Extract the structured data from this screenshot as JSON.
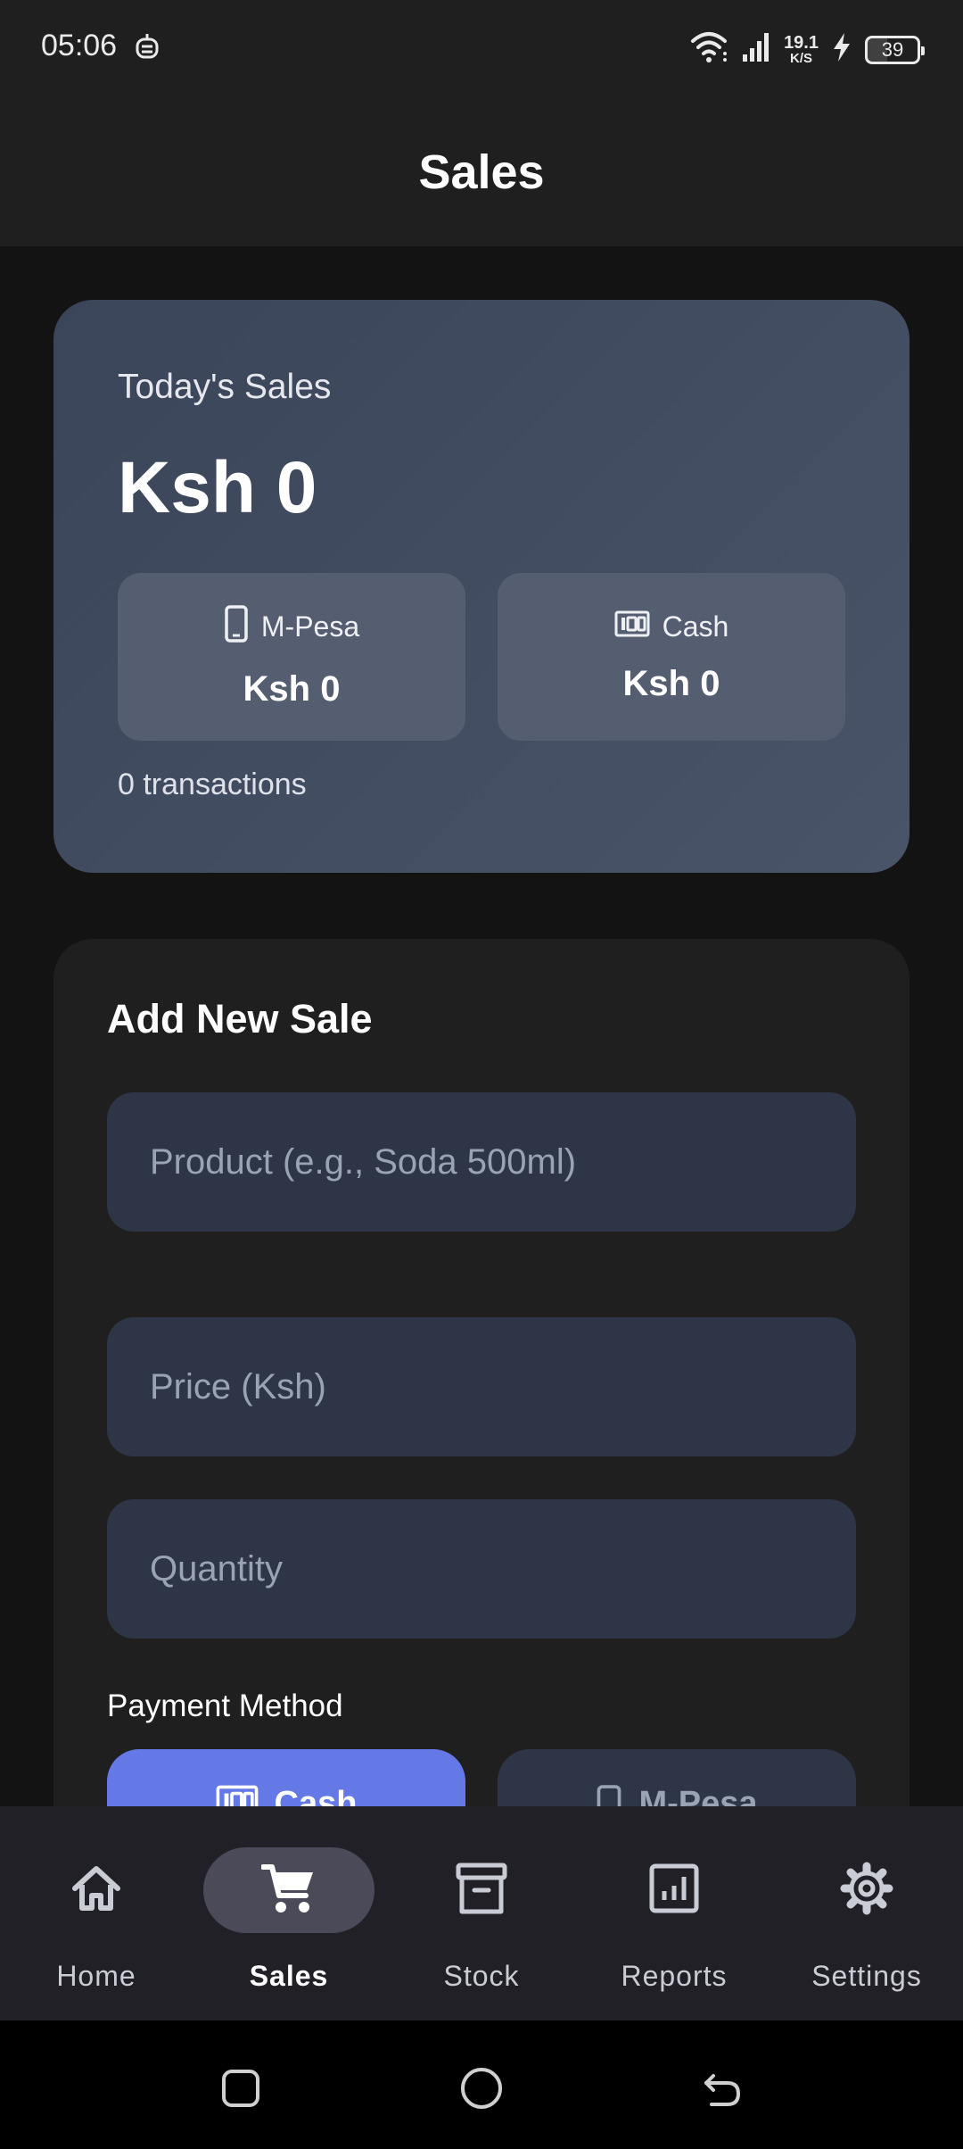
{
  "status_bar": {
    "time": "05:06",
    "net_speed_value": "19.1",
    "net_speed_unit": "K/S",
    "battery_level": "39",
    "icons": [
      "bot-icon",
      "wifi-icon",
      "signal-icon",
      "charging-icon",
      "battery-icon"
    ]
  },
  "header": {
    "title": "Sales"
  },
  "summary": {
    "label": "Today's Sales",
    "total": "Ksh 0",
    "mpesa": {
      "label": "M-Pesa",
      "amount": "Ksh 0",
      "icon": "phone-icon"
    },
    "cash": {
      "label": "Cash",
      "amount": "Ksh 0",
      "icon": "cash-icon"
    },
    "transactions": "0 transactions"
  },
  "form": {
    "title": "Add New Sale",
    "product": {
      "placeholder": "Product (e.g., Soda 500ml)",
      "value": ""
    },
    "price": {
      "placeholder": "Price (Ksh)",
      "value": ""
    },
    "quantity": {
      "placeholder": "Quantity",
      "value": ""
    },
    "payment_label": "Payment Method",
    "payment_options": [
      {
        "label": "Cash",
        "icon": "cash-icon",
        "selected": true
      },
      {
        "label": "M-Pesa",
        "icon": "phone-icon",
        "selected": false
      }
    ]
  },
  "nav": {
    "items": [
      {
        "label": "Home",
        "icon": "home-icon"
      },
      {
        "label": "Sales",
        "icon": "cart-icon",
        "active": true
      },
      {
        "label": "Stock",
        "icon": "archive-icon"
      },
      {
        "label": "Reports",
        "icon": "report-icon"
      },
      {
        "label": "Settings",
        "icon": "gear-icon"
      }
    ]
  },
  "colors": {
    "accent": "#6479e6",
    "card_gradient_start": "#3b4559",
    "card_gradient_end": "#4a5468",
    "field_bg": "#2d3547",
    "nav_bg": "#212027"
  }
}
